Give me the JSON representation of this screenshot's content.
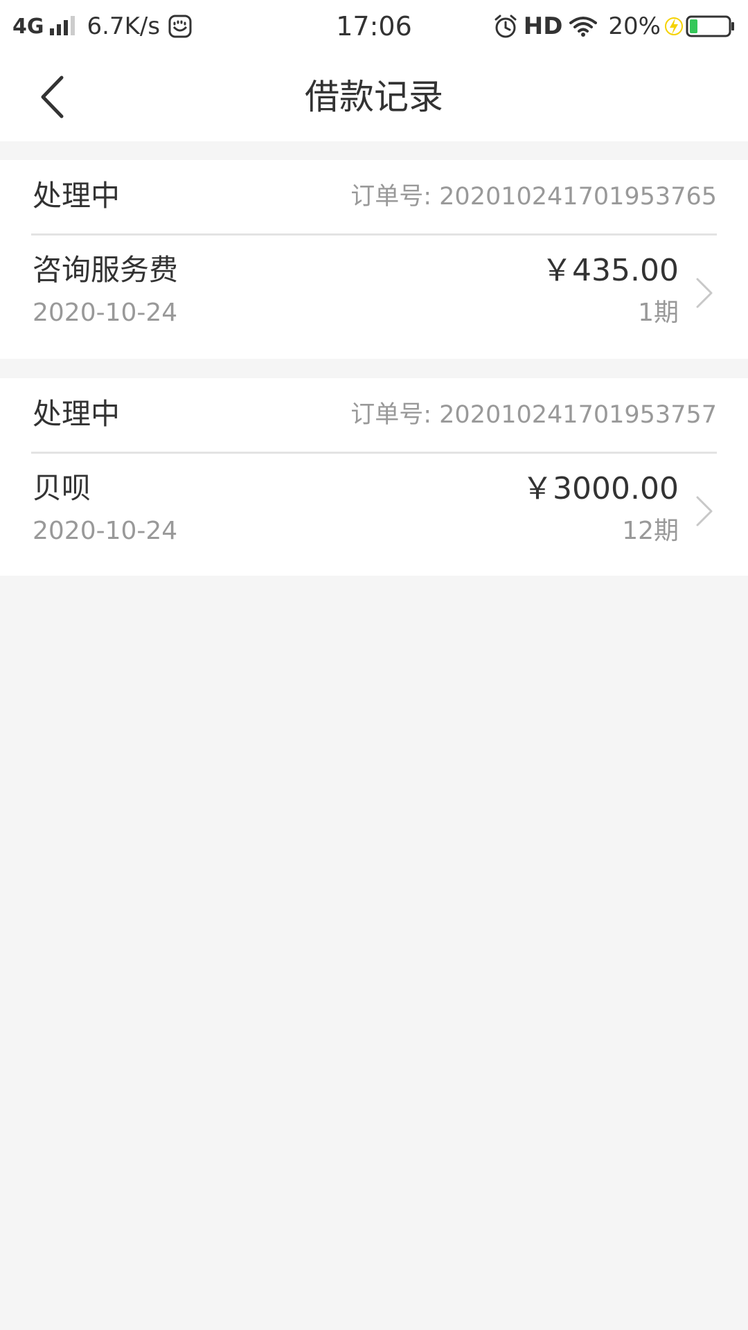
{
  "status_bar": {
    "network": "4G",
    "speed": "6.7K/s",
    "time": "17:06",
    "hd": "HD",
    "battery": "20%"
  },
  "header": {
    "title": "借款记录"
  },
  "records": [
    {
      "status": "处理中",
      "order_number": "订单号: 202010241701953765",
      "name": "咨询服务费",
      "date": "2020-10-24",
      "amount": "￥435.00",
      "term": "1期"
    },
    {
      "status": "处理中",
      "order_number": "订单号: 202010241701953757",
      "name": "贝呗",
      "date": "2020-10-24",
      "amount": "￥3000.00",
      "term": "12期"
    }
  ],
  "colors": {
    "background": "#f5f5f5",
    "card": "#ffffff",
    "text_primary": "#333333",
    "text_secondary": "#999999",
    "divider": "#e3e3e3",
    "battery_level": "#35c759",
    "charging_bolt": "#f5d200"
  }
}
